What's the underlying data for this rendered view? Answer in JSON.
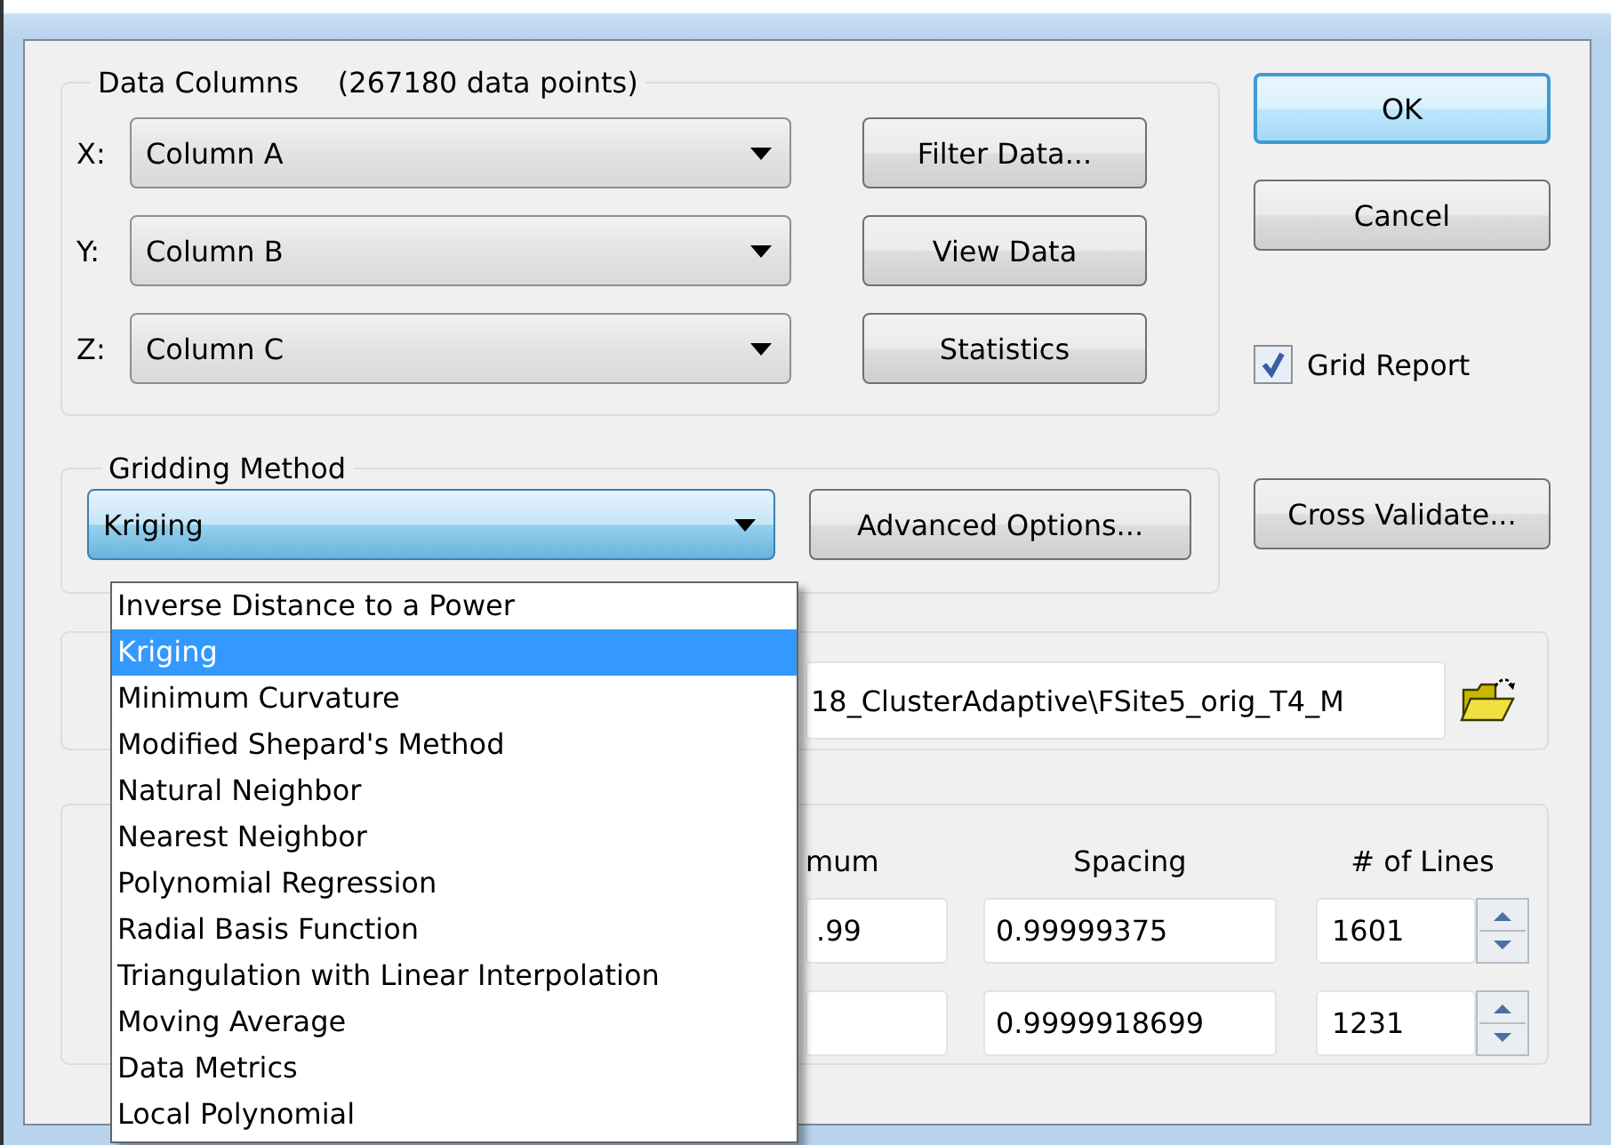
{
  "data_columns": {
    "title": "Data Columns",
    "count": "(267180 data points)",
    "axes": [
      {
        "label": "X:",
        "value": "Column A"
      },
      {
        "label": "Y:",
        "value": "Column B"
      },
      {
        "label": "Z:",
        "value": "Column C"
      }
    ]
  },
  "data_buttons": [
    "Filter Data...",
    "View Data",
    "Statistics"
  ],
  "dialog_buttons": [
    {
      "label": "OK",
      "default": true
    },
    {
      "label": "Cancel",
      "default": false
    }
  ],
  "grid_report": {
    "label": "Grid Report",
    "checked": true
  },
  "gridding_method": {
    "title": "Gridding Method",
    "value": "Kriging",
    "expanded": true,
    "options": [
      {
        "label": "Inverse Distance to a Power",
        "selected": false
      },
      {
        "label": "Kriging",
        "selected": true
      },
      {
        "label": "Minimum Curvature",
        "selected": false
      },
      {
        "label": "Modified Shepard's Method",
        "selected": false
      },
      {
        "label": "Natural Neighbor",
        "selected": false
      },
      {
        "label": "Nearest Neighbor",
        "selected": false
      },
      {
        "label": "Polynomial Regression",
        "selected": false
      },
      {
        "label": "Radial Basis Function",
        "selected": false
      },
      {
        "label": "Triangulation with Linear Interpolation",
        "selected": false
      },
      {
        "label": "Moving Average",
        "selected": false
      },
      {
        "label": "Data Metrics",
        "selected": false
      },
      {
        "label": "Local Polynomial",
        "selected": false
      }
    ]
  },
  "advanced_button": "Advanced Options...",
  "cross_validate_button": "Cross Validate...",
  "output": {
    "path": "18_ClusterAdaptive\\FSite5_orig_T4_M"
  },
  "grid_lines": {
    "columns": [
      "mum",
      "Spacing",
      "# of Lines"
    ],
    "rows": [
      {
        "maximum": ".99",
        "spacing": "0.99999375",
        "lines": "1601"
      },
      {
        "spacing": "0.9999918699",
        "lines": "1231"
      }
    ]
  }
}
